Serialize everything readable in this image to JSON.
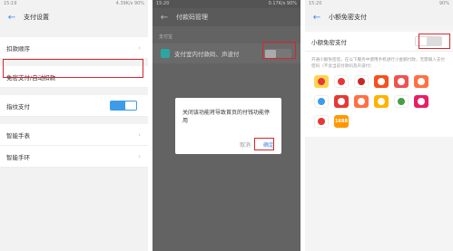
{
  "screens": {
    "settings": {
      "status_time": "15:19",
      "status_right": "4.39K/s 90%",
      "title": "支付设置",
      "rows": [
        {
          "label": "扣款顺序"
        },
        {
          "label": "免密支付/自动扣款"
        },
        {
          "label": "指纹支付"
        },
        {
          "label": "智能手表"
        },
        {
          "label": "智能手环"
        }
      ],
      "fingerprint_toggle": "on"
    },
    "payment_code": {
      "status_time": "15:20",
      "status_right": "0.17K/s 90%",
      "title": "付款码管理",
      "section": "支付宝",
      "row_label": "支付室内付款码、声波付",
      "dialog": {
        "message": "关闭该功能将导致首页的付钱功能停用",
        "cancel": "取消",
        "confirm": "确定"
      }
    },
    "small_free": {
      "status_time": "15:20",
      "status_right": "90%",
      "title": "小额免密支付",
      "row_label": "小额免密支付",
      "description": "开通小额免密后，在以下服务中使用手机进行小金额付款，无需输入支付密码（不含当前付款码及声波付）",
      "toggle": "off"
    }
  },
  "colors": {
    "accent": "#3d9be9",
    "highlight": "#d6262e"
  },
  "merchant_logos": [
    {
      "icon": "juhuasuan-logo",
      "color": "#e53935",
      "bg": "#ffd54f"
    },
    {
      "icon": "weibo-logo",
      "color": "#e53935",
      "bg": "#ffffff"
    },
    {
      "icon": "tmall-logo",
      "color": "#c62828",
      "bg": "#ffffff"
    },
    {
      "icon": "alipay-red-logo",
      "color": "#ffffff",
      "bg": "#f4511e"
    },
    {
      "icon": "xiami-logo",
      "color": "#ffffff",
      "bg": "#ef5350"
    },
    {
      "icon": "fish-logo",
      "color": "#ffffff",
      "bg": "#ff7043"
    },
    {
      "icon": "taobao-logo",
      "color": "#3d9be9",
      "bg": "#ffffff"
    },
    {
      "icon": "lion-logo",
      "color": "#ffffff",
      "bg": "#e53935"
    },
    {
      "icon": "koubei-logo",
      "color": "#ffffff",
      "bg": "#ff7043"
    },
    {
      "icon": "tmall-cat-logo",
      "color": "#ffffff",
      "bg": "#ffb300"
    },
    {
      "icon": "youku-logo",
      "color": "#43a047",
      "bg": "#ffffff"
    },
    {
      "icon": "eleme-logo",
      "color": "#ffffff",
      "bg": "#e91e63"
    },
    {
      "icon": "cainiao-logo",
      "color": "#e53935",
      "bg": "#ffffff"
    },
    {
      "icon": "1688-logo",
      "color": "#ffffff",
      "bg": "#ff9800",
      "label": "1688"
    }
  ]
}
